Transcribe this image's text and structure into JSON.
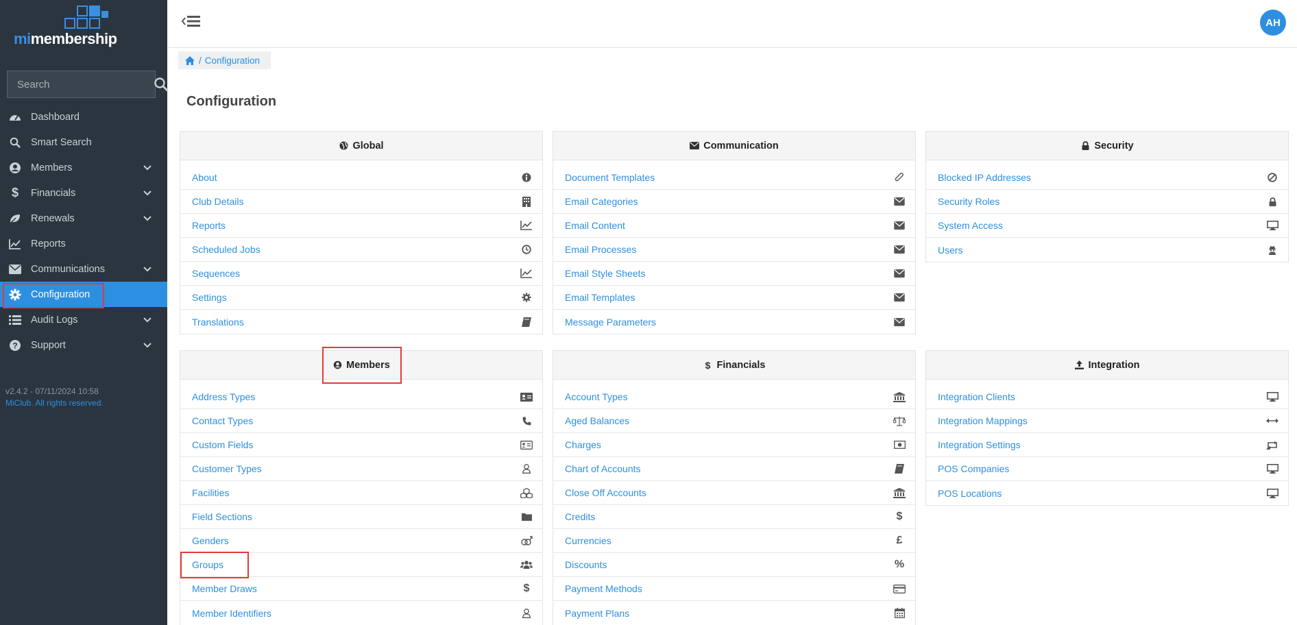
{
  "app": {
    "logo_prefix": "mi",
    "logo_suffix": "membership",
    "user_initials": "AH"
  },
  "colors": {
    "sidebar_bg": "#2b3540",
    "accent": "#2d8fe0",
    "highlight": "#e53935"
  },
  "sidebar": {
    "search_placeholder": "Search",
    "items": [
      {
        "label": "Dashboard",
        "icon": "dashboard-icon",
        "expandable": false
      },
      {
        "label": "Smart Search",
        "icon": "search-icon",
        "expandable": false
      },
      {
        "label": "Members",
        "icon": "user-circle-icon",
        "expandable": true
      },
      {
        "label": "Financials",
        "icon": "dollar-icon",
        "expandable": true
      },
      {
        "label": "Renewals",
        "icon": "leaf-icon",
        "expandable": true
      },
      {
        "label": "Reports",
        "icon": "line-chart-icon",
        "expandable": false
      },
      {
        "label": "Communications",
        "icon": "envelope-icon",
        "expandable": true
      },
      {
        "label": "Configuration",
        "icon": "gear-icon",
        "expandable": false,
        "active": true
      },
      {
        "label": "Audit Logs",
        "icon": "list-icon",
        "expandable": true
      },
      {
        "label": "Support",
        "icon": "question-circle-icon",
        "expandable": true
      }
    ],
    "version": "v2.4.2 - 07/11/2024 10:58",
    "copyright": "MiClub. All rights reserved."
  },
  "breadcrumb": {
    "separator": "/",
    "current": "Configuration"
  },
  "page": {
    "title": "Configuration"
  },
  "panels": {
    "global": {
      "title": "Global",
      "icon": "globe-icon",
      "items": [
        {
          "label": "About",
          "icon": "info-icon"
        },
        {
          "label": "Club Details",
          "icon": "building-icon"
        },
        {
          "label": "Reports",
          "icon": "line-chart-icon"
        },
        {
          "label": "Scheduled Jobs",
          "icon": "clock-icon"
        },
        {
          "label": "Sequences",
          "icon": "line-chart-icon"
        },
        {
          "label": "Settings",
          "icon": "gear-icon"
        },
        {
          "label": "Translations",
          "icon": "book-icon"
        }
      ]
    },
    "communication": {
      "title": "Communication",
      "icon": "envelope-icon",
      "items": [
        {
          "label": "Document Templates",
          "icon": "paperclip-icon"
        },
        {
          "label": "Email Categories",
          "icon": "envelope-icon"
        },
        {
          "label": "Email Content",
          "icon": "envelope-icon"
        },
        {
          "label": "Email Processes",
          "icon": "envelope-icon"
        },
        {
          "label": "Email Style Sheets",
          "icon": "envelope-icon"
        },
        {
          "label": "Email Templates",
          "icon": "envelope-icon"
        },
        {
          "label": "Message Parameters",
          "icon": "envelope-icon"
        }
      ]
    },
    "security": {
      "title": "Security",
      "icon": "lock-icon",
      "items": [
        {
          "label": "Blocked IP Addresses",
          "icon": "ban-icon"
        },
        {
          "label": "Security Roles",
          "icon": "lock-icon"
        },
        {
          "label": "System Access",
          "icon": "monitor-icon"
        },
        {
          "label": "Users",
          "icon": "user-secret-icon"
        }
      ]
    },
    "members": {
      "title": "Members",
      "icon": "user-circle-icon",
      "items": [
        {
          "label": "Address Types",
          "icon": "address-card-icon"
        },
        {
          "label": "Contact Types",
          "icon": "phone-icon"
        },
        {
          "label": "Custom Fields",
          "icon": "id-card-icon"
        },
        {
          "label": "Customer Types",
          "icon": "user-icon"
        },
        {
          "label": "Facilities",
          "icon": "cubes-icon"
        },
        {
          "label": "Field Sections",
          "icon": "folder-icon"
        },
        {
          "label": "Genders",
          "icon": "genderless-icon"
        },
        {
          "label": "Groups",
          "icon": "users-icon"
        },
        {
          "label": "Member Draws",
          "icon": "dollar-icon"
        },
        {
          "label": "Member Identifiers",
          "icon": "user-icon"
        }
      ]
    },
    "financials": {
      "title": "Financials",
      "icon": "dollar-icon",
      "items": [
        {
          "label": "Account Types",
          "icon": "bank-icon"
        },
        {
          "label": "Aged Balances",
          "icon": "balance-scale-icon"
        },
        {
          "label": "Charges",
          "icon": "money-icon"
        },
        {
          "label": "Chart of Accounts",
          "icon": "book-icon"
        },
        {
          "label": "Close Off Accounts",
          "icon": "bank-icon"
        },
        {
          "label": "Credits",
          "icon": "dollar-icon"
        },
        {
          "label": "Currencies",
          "icon": "pound-icon"
        },
        {
          "label": "Discounts",
          "icon": "percent-icon"
        },
        {
          "label": "Payment Methods",
          "icon": "credit-card-icon"
        },
        {
          "label": "Payment Plans",
          "icon": "calendar-icon"
        }
      ]
    },
    "integration": {
      "title": "Integration",
      "icon": "upload-icon",
      "items": [
        {
          "label": "Integration Clients",
          "icon": "monitor-icon"
        },
        {
          "label": "Integration Mappings",
          "icon": "arrows-h-icon"
        },
        {
          "label": "Integration Settings",
          "icon": "retweet-icon"
        },
        {
          "label": "POS Companies",
          "icon": "monitor-icon"
        },
        {
          "label": "POS Locations",
          "icon": "monitor-icon"
        }
      ]
    }
  }
}
